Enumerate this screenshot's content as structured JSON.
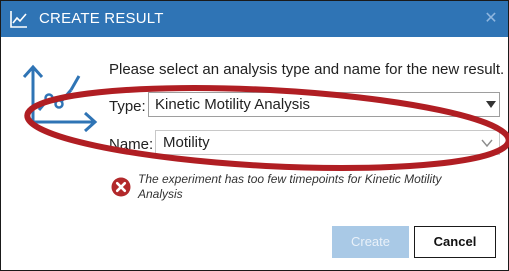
{
  "dialog": {
    "title": "CREATE RESULT",
    "close_glyph": "✕",
    "prompt": "Please select an analysis type and name for the new result."
  },
  "form": {
    "type_label": "Type:",
    "type_value": "Kinetic Motility Analysis",
    "name_label": "Name:",
    "name_value": "Motility"
  },
  "error": {
    "message": "The experiment has too few timepoints for Kinetic Motility Analysis",
    "icon": "error-x-icon",
    "color": "#b2292b"
  },
  "buttons": {
    "create_label": "Create",
    "create_enabled": false,
    "cancel_label": "Cancel"
  },
  "icons": {
    "title": "chart-icon",
    "main": "line-chart-icon",
    "type_caret": "caret-down-icon",
    "name_chevron": "chevron-down-icon"
  },
  "colors": {
    "titlebar": "#2f74b5",
    "accent": "#2f74b5",
    "annotation": "#b01e23"
  }
}
